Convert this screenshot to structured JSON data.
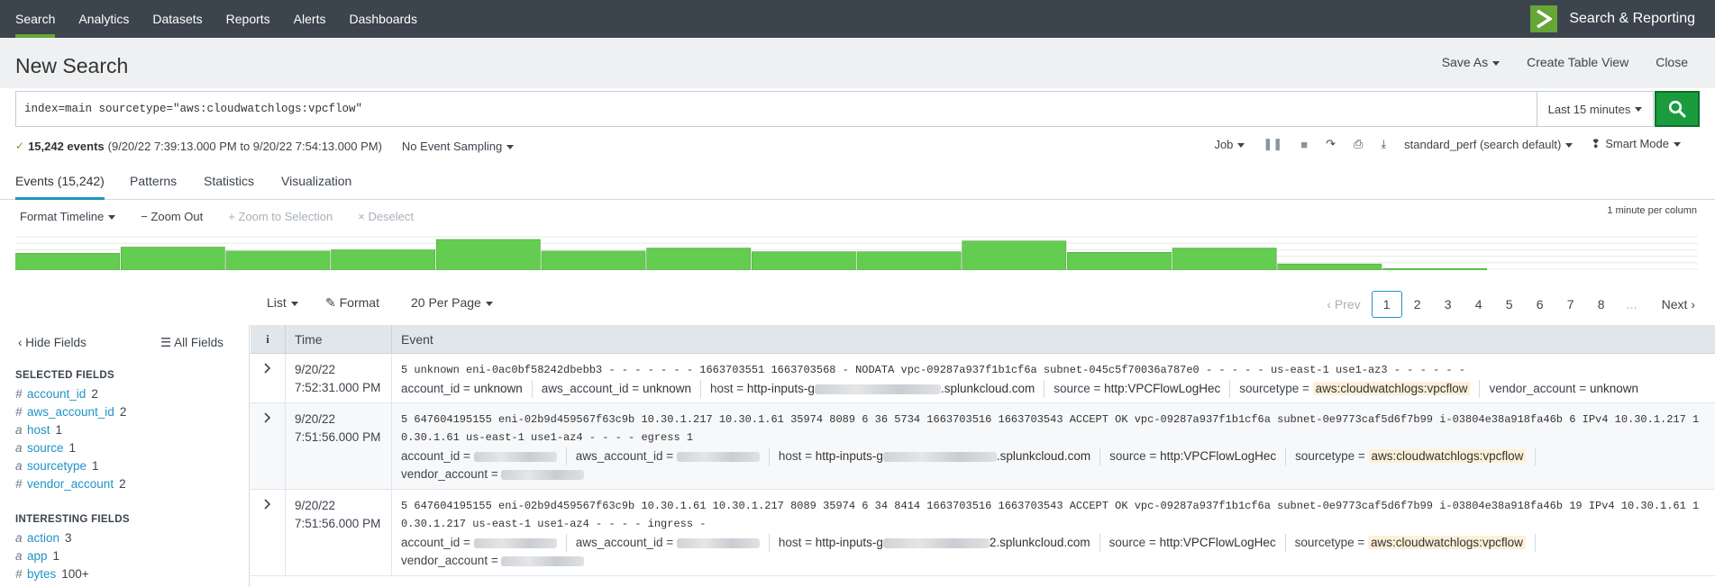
{
  "topnav": {
    "items": [
      "Search",
      "Analytics",
      "Datasets",
      "Reports",
      "Alerts",
      "Dashboards"
    ],
    "active": "Search",
    "app_name": "Search & Reporting"
  },
  "header": {
    "title": "New Search",
    "save_as": "Save As",
    "create_table_view": "Create Table View",
    "close": "Close"
  },
  "search": {
    "query": "index=main sourcetype=\"aws:cloudwatchlogs:vpcflow\"",
    "time_range": "Last 15 minutes"
  },
  "status": {
    "events": "15,242 events",
    "range": "(9/20/22 7:39:13.000 PM to 9/20/22 7:54:13.000 PM)",
    "sampling": "No Event Sampling",
    "job": "Job",
    "perf": "standard_perf (search default)",
    "mode": "Smart Mode"
  },
  "tabs": [
    "Events (15,242)",
    "Patterns",
    "Statistics",
    "Visualization"
  ],
  "timeline": {
    "format": "Format Timeline",
    "zoom_out": "Zoom Out",
    "zoom_selection": "Zoom to Selection",
    "deselect": "Deselect",
    "per_column": "1 minute per column",
    "bars": [
      0.55,
      0.75,
      0.62,
      0.66,
      1.0,
      0.62,
      0.72,
      0.6,
      0.6,
      0.95,
      0.58,
      0.72,
      0.2,
      0.05,
      0.0,
      0.0
    ]
  },
  "list_controls": {
    "list": "List",
    "format": "Format",
    "per_page": "20 Per Page",
    "prev": "Prev",
    "pages": [
      "1",
      "2",
      "3",
      "4",
      "5",
      "6",
      "7",
      "8"
    ],
    "ellipsis": "...",
    "next": "Next"
  },
  "sidebar": {
    "hide_fields": "Hide Fields",
    "all_fields": "All Fields",
    "selected_heading": "SELECTED FIELDS",
    "selected": [
      {
        "type": "#",
        "name": "account_id",
        "count": "2"
      },
      {
        "type": "#",
        "name": "aws_account_id",
        "count": "2"
      },
      {
        "type": "a",
        "name": "host",
        "count": "1"
      },
      {
        "type": "a",
        "name": "source",
        "count": "1"
      },
      {
        "type": "a",
        "name": "sourcetype",
        "count": "1"
      },
      {
        "type": "#",
        "name": "vendor_account",
        "count": "2"
      }
    ],
    "interesting_heading": "INTERESTING FIELDS",
    "interesting": [
      {
        "type": "a",
        "name": "action",
        "count": "3"
      },
      {
        "type": "a",
        "name": "app",
        "count": "1"
      },
      {
        "type": "#",
        "name": "bytes",
        "count": "100+"
      }
    ]
  },
  "results": {
    "col_i": "i",
    "col_time": "Time",
    "col_event": "Event",
    "events": [
      {
        "date": "9/20/22",
        "time": "7:52:31.000 PM",
        "raw": "5 unknown eni-0ac0bf58242dbebb3 - - - - - - - 1663703551 1663703568 - NODATA vpc-09287a937f1b1cf6a subnet-045c5f70036a787e0 - - - - - us-east-1 use1-az3 - - - - - -",
        "account_id": "unknown",
        "aws_account_id": "unknown",
        "host_prefix": "http-inputs-g",
        "host_suffix": ".splunkcloud.com",
        "source": "http:VPCFlowLogHec",
        "sourcetype": "aws:cloudwatchlogs:vpcflow",
        "vendor_account": "unknown"
      },
      {
        "date": "9/20/22",
        "time": "7:51:56.000 PM",
        "raw": "5 647604195155 eni-02b9d459567f63c9b 10.30.1.217 10.30.1.61 35974 8089 6 36 5734 1663703516 1663703543 ACCEPT OK vpc-09287a937f1b1cf6a subnet-0e9773caf5d6f7b99 i-03804e38a918fa46b 6 IPv4 10.30.1.217 10.30.1.61 us-east-1 use1-az4 - - - - egress 1",
        "host_prefix": "http-inputs-g",
        "host_suffix": ".splunkcloud.com",
        "source": "http:VPCFlowLogHec",
        "sourcetype": "aws:cloudwatchlogs:vpcflow"
      },
      {
        "date": "9/20/22",
        "time": "7:51:56.000 PM",
        "raw": "5 647604195155 eni-02b9d459567f63c9b 10.30.1.61 10.30.1.217 8089 35974 6 34 8414 1663703516 1663703543 ACCEPT OK vpc-09287a937f1b1cf6a subnet-0e9773caf5d6f7b99 i-03804e38a918fa46b 19 IPv4 10.30.1.61 10.30.1.217 us-east-1 use1-az4 - - - - ingress -",
        "host_prefix": "http-inputs-g",
        "host_suffix": "2.splunkcloud.com",
        "source": "http:VPCFlowLogHec",
        "sourcetype": "aws:cloudwatchlogs:vpcflow"
      }
    ]
  },
  "colors": {
    "topbar": "#3c444d",
    "accent_green": "#65a637",
    "search_button": "#1a9c3e",
    "link_blue": "#1e93c6",
    "timeline_bar": "#65cc52"
  }
}
